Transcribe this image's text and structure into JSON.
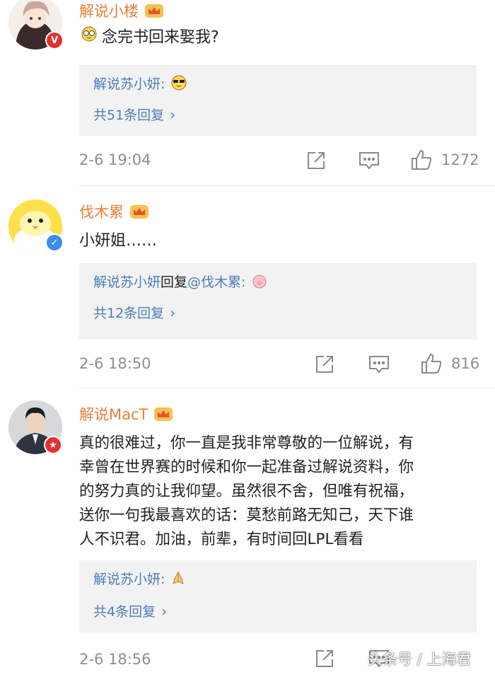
{
  "comments": [
    {
      "username": "解说小楼",
      "text": "念完书回来娶我?",
      "reply_preview": "解说苏小妍:",
      "reply_count_label": "共51条回复",
      "timestamp": "2-6 19:04",
      "like_count": "1272"
    },
    {
      "username": "伐木累",
      "text": "小妍姐……",
      "reply_author": "解说苏小妍",
      "reply_verb": "回复",
      "reply_target": "@伐木累",
      "reply_colon": ":",
      "reply_count_label": "共12条回复",
      "timestamp": "2-6 18:50",
      "like_count": "816"
    },
    {
      "username": "解说MacT",
      "text_lines": [
        "真的很难过，你一直是我非常尊敬的一位解说，有",
        "幸曾在世界赛的时候和你一起准备过解说资料，你",
        "的努力真的让我仰望。虽然很不舍，但唯有祝福，",
        "送你一句我最喜欢的话：莫愁前路无知己，天下谁",
        "人不识君。加油，前辈，有时间回LPL看看"
      ],
      "reply_preview": "解说苏小妍:",
      "reply_count_label": "共4条回复",
      "timestamp": "2-6 18:56"
    }
  ],
  "watermark": "头条号 / 上海君",
  "icons": [
    "share-icon",
    "comment-icon",
    "like-icon",
    "crown-icon",
    "chevron-right-icon"
  ],
  "colors": {
    "username": "#e8803a",
    "link": "#4f7db8",
    "reply_bg": "#f2f2f2",
    "meta": "#8f8f8f"
  }
}
